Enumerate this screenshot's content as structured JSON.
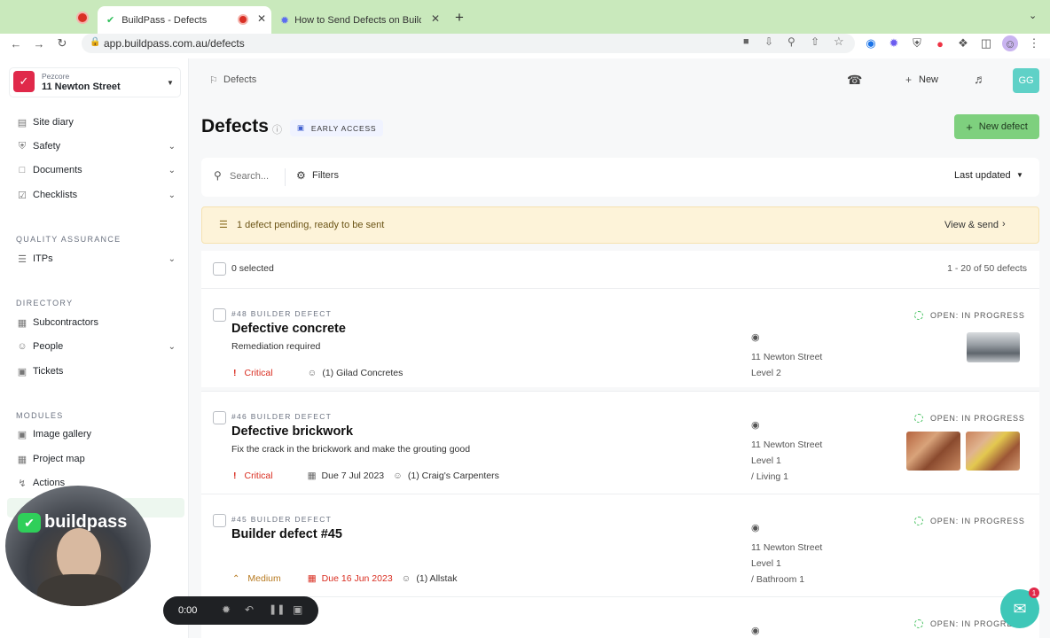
{
  "browser": {
    "tabs": [
      {
        "title": "BuildPass - Defects",
        "active": true
      },
      {
        "title": "How to Send Defects on BuildPass",
        "active": false
      }
    ],
    "url": "app.buildpass.com.au/defects"
  },
  "sidebar": {
    "org": "Pezcore",
    "project": "11 Newton Street",
    "items": [
      {
        "label": "Site diary",
        "icon": "book-icon",
        "expandable": false
      },
      {
        "label": "Safety",
        "icon": "shield-icon",
        "expandable": true
      },
      {
        "label": "Documents",
        "icon": "folder-icon",
        "expandable": true
      },
      {
        "label": "Checklists",
        "icon": "checklist-icon",
        "expandable": true
      }
    ],
    "qa_section": "QUALITY ASSURANCE",
    "qa_items": [
      {
        "label": "ITPs",
        "icon": "list-icon",
        "expandable": true
      }
    ],
    "directory_section": "DIRECTORY",
    "directory_items": [
      {
        "label": "Subcontractors",
        "icon": "building-icon",
        "expandable": false
      },
      {
        "label": "People",
        "icon": "people-icon",
        "expandable": true
      },
      {
        "label": "Tickets",
        "icon": "ticket-icon",
        "expandable": false
      }
    ],
    "modules_section": "MODULES",
    "module_items": [
      {
        "label": "Image gallery",
        "icon": "image-icon"
      },
      {
        "label": "Project map",
        "icon": "map-icon"
      },
      {
        "label": "Actions",
        "icon": "lightning-icon"
      }
    ]
  },
  "topbar": {
    "breadcrumb": "Defects",
    "new_label": "New",
    "avatar": "GG"
  },
  "page": {
    "title": "Defects",
    "badge": "EARLY ACCESS",
    "new_defect_label": "New defect",
    "search_placeholder": "Search...",
    "filters_label": "Filters",
    "sort_label": "Last updated",
    "banner_text": "1 defect pending, ready to be sent",
    "banner_action": "View & send",
    "selected_text": "0 selected",
    "pagination": "1 - 20 of 50 defects"
  },
  "defects": [
    {
      "kicker": "#48 BUILDER DEFECT",
      "title": "Defective concrete",
      "description": "Remediation required",
      "priority": "Critical",
      "due": "",
      "assignee": "(1)  Gilad Concretes",
      "location": [
        "11 Newton Street",
        "Level 2"
      ],
      "status": "OPEN: IN PROGRESS"
    },
    {
      "kicker": "#46 BUILDER DEFECT",
      "title": "Defective brickwork",
      "description": "Fix the crack in the brickwork and make the grouting good",
      "priority": "Critical",
      "due": "Due  7 Jul 2023",
      "assignee": "(1)  Craig's Carpenters",
      "location": [
        "11 Newton Street",
        "Level 1",
        "/ Living 1"
      ],
      "status": "OPEN: IN PROGRESS"
    },
    {
      "kicker": "#45 BUILDER DEFECT",
      "title": "Builder defect #45",
      "description": "",
      "priority": "Medium",
      "due": "Due  16 Jun 2023",
      "assignee": "(1)  Allstak",
      "location": [
        "11 Newton Street",
        "Level 1",
        "/ Bathroom 1"
      ],
      "status": "OPEN: IN PROGRESS"
    },
    {
      "kicker": "",
      "title": "",
      "status": "OPEN: IN PROGRESS"
    }
  ],
  "overlay": {
    "brand": "buildpass",
    "timer": "0:00",
    "chat_badge": "1"
  },
  "colors": {
    "critical": "#d92d20",
    "medium": "#b7791f",
    "status_green": "#3fbf5a",
    "accent_green": "#7ed07e",
    "avatar": "#5fd1c7",
    "banner": "#fdf3d9"
  }
}
